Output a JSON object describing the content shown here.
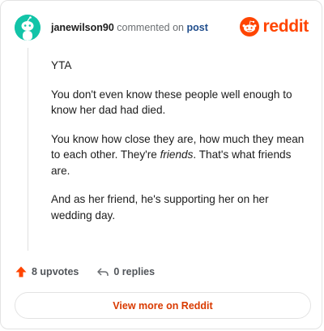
{
  "header": {
    "username": "janewilson90",
    "action_text": "commented on",
    "post_link": "post"
  },
  "brand": {
    "logo_icon": "reddit-alien-icon",
    "wordmark": "reddit",
    "color": "#ff4500"
  },
  "avatar": {
    "icon": "default-snoo-avatar-icon",
    "color": "#12c4a8"
  },
  "comment": {
    "paragraphs": [
      {
        "text": "YTA"
      },
      {
        "text": "You don't even know these people well enough to know her dad had died."
      },
      {
        "before": "You know how close they are, how much they mean to each other. They're ",
        "emphasis": "friends",
        "after": ". That's what friends are."
      },
      {
        "text": "And as her friend, he's supporting her on her wedding day."
      }
    ]
  },
  "footer": {
    "upvotes_label": "8 upvotes",
    "replies_label": "0 replies",
    "upvote_icon": "upvote-arrow-icon",
    "reply_icon": "reply-arrow-icon",
    "upvote_color": "#ff4500"
  },
  "cta": {
    "label": "View more on Reddit",
    "color": "#d93a00"
  }
}
